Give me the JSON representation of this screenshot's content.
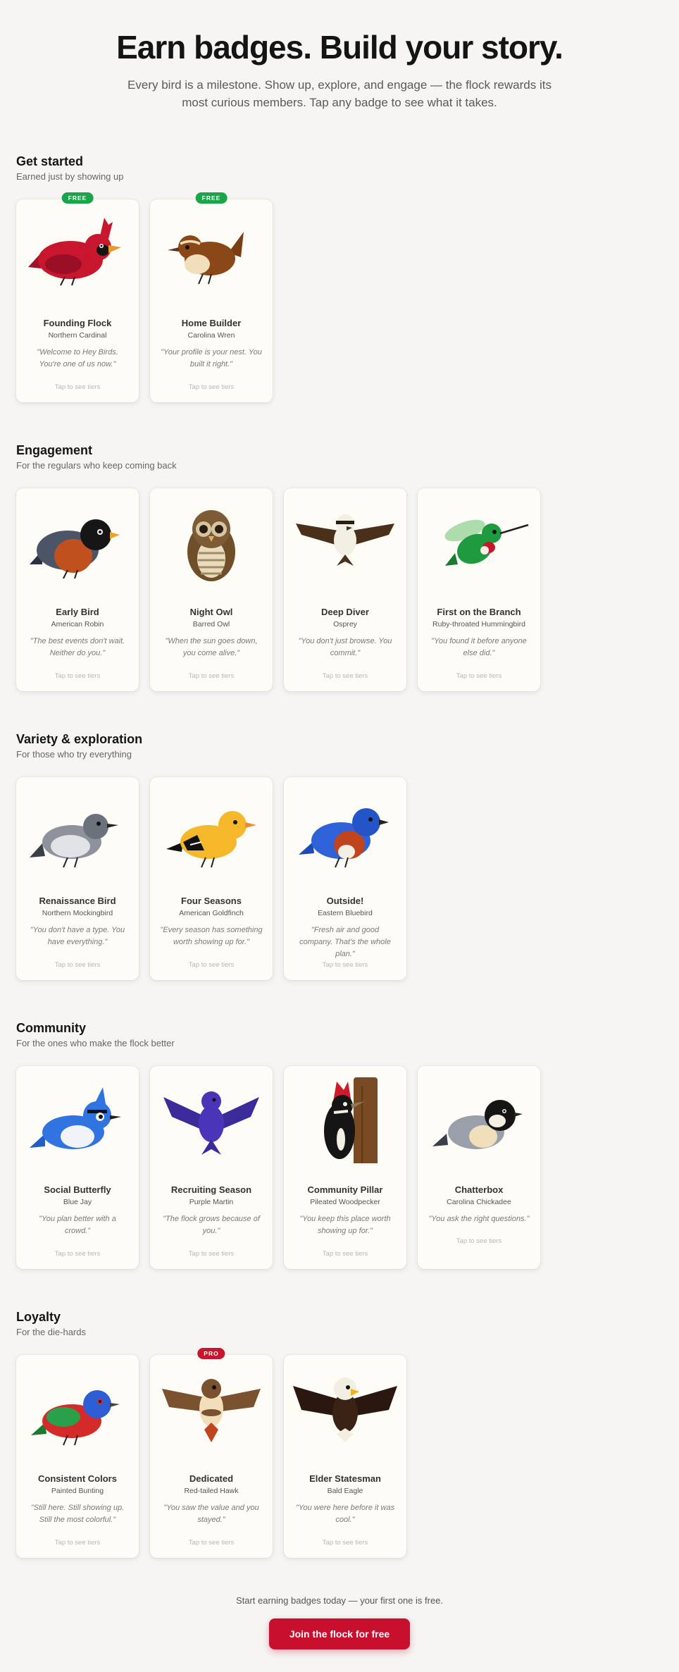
{
  "hero": {
    "title": "Earn badges. Build your story.",
    "subtitle": "Every bird is a milestone. Show up, explore, and engage — the flock rewards its most curious members. Tap any badge to see what it takes."
  },
  "sections": [
    {
      "title": "Get started",
      "subtitle": "Earned just by showing up",
      "badges": [
        {
          "name": "Founding Flock",
          "species": "Northern Cardinal",
          "quote": "\"Welcome to Hey Birds. You're one of us now.\"",
          "tap": "Tap to see tiers",
          "tag": "FREE",
          "icon": "cardinal-icon"
        },
        {
          "name": "Home Builder",
          "species": "Carolina Wren",
          "quote": "\"Your profile is your nest. You built it right.\"",
          "tap": "Tap to see tiers",
          "tag": "FREE",
          "icon": "wren-icon"
        }
      ]
    },
    {
      "title": "Engagement",
      "subtitle": "For the regulars who keep coming back",
      "badges": [
        {
          "name": "Early Bird",
          "species": "American Robin",
          "quote": "\"The best events don't wait. Neither do you.\"",
          "tap": "Tap to see tiers",
          "icon": "robin-icon"
        },
        {
          "name": "Night Owl",
          "species": "Barred Owl",
          "quote": "\"When the sun goes down, you come alive.\"",
          "tap": "Tap to see tiers",
          "icon": "owl-icon"
        },
        {
          "name": "Deep Diver",
          "species": "Osprey",
          "quote": "\"You don't just browse. You commit.\"",
          "tap": "Tap to see tiers",
          "icon": "osprey-icon"
        },
        {
          "name": "First on the Branch",
          "species": "Ruby-throated Hummingbird",
          "quote": "\"You found it before anyone else did.\"",
          "tap": "Tap to see tiers",
          "icon": "hummingbird-icon"
        }
      ]
    },
    {
      "title": "Variety & exploration",
      "subtitle": "For those who try everything",
      "badges": [
        {
          "name": "Renaissance Bird",
          "species": "Northern Mockingbird",
          "quote": "\"You don't have a type. You have everything.\"",
          "tap": "Tap to see tiers",
          "icon": "mockingbird-icon"
        },
        {
          "name": "Four Seasons",
          "species": "American Goldfinch",
          "quote": "\"Every season has something worth showing up for.\"",
          "tap": "Tap to see tiers",
          "icon": "goldfinch-icon"
        },
        {
          "name": "Outside!",
          "species": "Eastern Bluebird",
          "quote": "\"Fresh air and good company. That's the whole plan.\"",
          "tap": "Tap to see tiers",
          "icon": "bluebird-icon"
        }
      ]
    },
    {
      "title": "Community",
      "subtitle": "For the ones who make the flock better",
      "badges": [
        {
          "name": "Social Butterfly",
          "species": "Blue Jay",
          "quote": "\"You plan better with a crowd.\"",
          "tap": "Tap to see tiers",
          "icon": "bluejay-icon"
        },
        {
          "name": "Recruiting Season",
          "species": "Purple Martin",
          "quote": "\"The flock grows because of you.\"",
          "tap": "Tap to see tiers",
          "icon": "martin-icon"
        },
        {
          "name": "Community Pillar",
          "species": "Pileated Woodpecker",
          "quote": "\"You keep this place worth showing up for.\"",
          "tap": "Tap to see tiers",
          "icon": "woodpecker-icon"
        },
        {
          "name": "Chatterbox",
          "species": "Carolina Chickadee",
          "quote": "\"You ask the right questions.\"",
          "tap": "Tap to see tiers",
          "icon": "chickadee-icon"
        }
      ]
    },
    {
      "title": "Loyalty",
      "subtitle": "For the die-hards",
      "badges": [
        {
          "name": "Consistent Colors",
          "species": "Painted Bunting",
          "quote": "\"Still here. Still showing up. Still the most colorful.\"",
          "tap": "Tap to see tiers",
          "icon": "bunting-icon"
        },
        {
          "name": "Dedicated",
          "species": "Red-tailed Hawk",
          "quote": "\"You saw the value and you stayed.\"",
          "tap": "Tap to see tiers",
          "tag": "PRO",
          "icon": "hawk-icon"
        },
        {
          "name": "Elder Statesman",
          "species": "Bald Eagle",
          "quote": "\"You were here before it was cool.\"",
          "tap": "Tap to see tiers",
          "icon": "eagle-icon"
        }
      ]
    }
  ],
  "footer": {
    "text": "Start earning badges today — your first one is free.",
    "cta": "Join the flock for free"
  },
  "colors": {
    "accent": "#c8102e",
    "free": "#1aa54a",
    "pro": "#c8162e",
    "card": "#fdfcf6",
    "page": "#f6f5f3"
  }
}
